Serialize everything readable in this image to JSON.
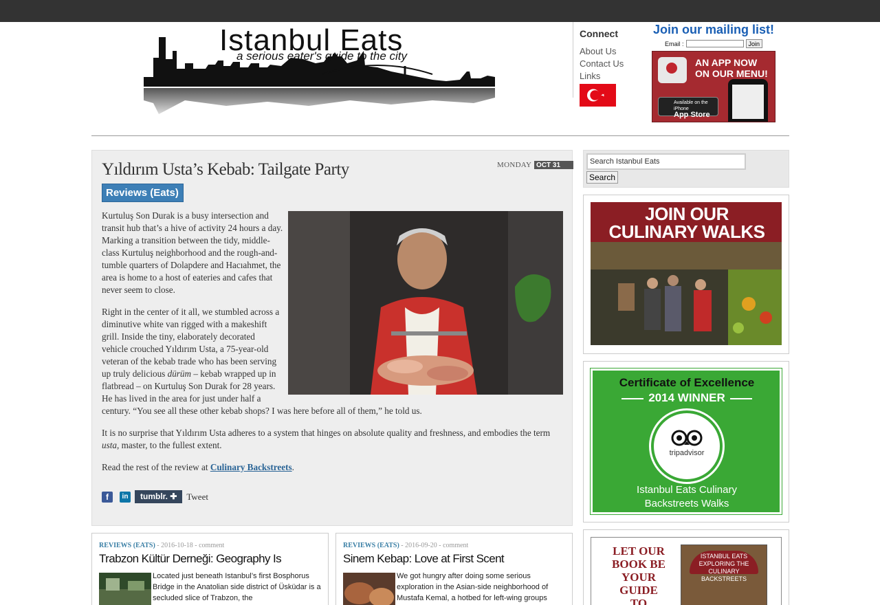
{
  "header": {
    "logo_title": "Istanbul Eats",
    "logo_tagline": "a serious eater's guide to the city",
    "connect": {
      "title": "Connect",
      "links": [
        "About Us",
        "Contact Us",
        "Links"
      ]
    },
    "mailing": {
      "title": "Join our mailing list!",
      "email_label": "Email :",
      "email_value": "",
      "join_label": "Join"
    },
    "app_ad": {
      "line1": "AN APP NOW",
      "line2": "ON OUR MENU!",
      "store_small": "Available on the iPhone",
      "store_big": "App Store"
    }
  },
  "article": {
    "title": "Yıldırım Usta’s Kebab: Tailgate Party",
    "day": "MONDAY",
    "date": "OCT 31",
    "category": "Reviews (Eats)",
    "p1": "Kurtuluş Son Durak is a busy intersection and transit hub that’s a hive of activity 24 hours a day. Marking a transition between the tidy, middle-class Kurtuluş neighborhood and the rough-and-tumble quarters of Dolapdere and Hacıahmet, the area is home to a host of eateries and cafes that never seem to close.",
    "p2a": "Right in the center of it all, we stumbled across a diminutive white van rigged with a makeshift grill. Inside the tiny, elaborately decorated vehicle crouched Yıldırım Usta, a 75-year-old veteran of the kebab trade who has been serving up truly delicious ",
    "p2em": "dürüm",
    "p2b": " – kebab wrapped up in flatbread – on Kurtuluş Son Durak for 28 years. He has lived in the area for just under half a century. “You see all these other kebab shops? I was here before all of them,” he told us.",
    "p3a": "It is no surprise that Yıldırım Usta adheres to a system that hinges on absolute quality and freshness, and embodies the term ",
    "p3em": "usta",
    "p3b": ", master, to the fullest extent.",
    "p4a": "Read the rest of the review at ",
    "p4link": "Culinary Backstreets",
    "p4b": ".",
    "share": {
      "facebook": "f",
      "linkedin": "in",
      "tumblr": "tumblr. ✚",
      "tweet": "Tweet"
    }
  },
  "teasers": [
    {
      "category": "REVIEWS (EATS)",
      "date": " - 2016-10-18 - ",
      "comment": "comment",
      "title": "Trabzon Kültür Derneği: Geography Is",
      "excerpt": "Located just beneath Istanbul’s first Bosphorus Bridge in the Anatolian side district of Üsküdar is a secluded slice of Trabzon, the"
    },
    {
      "category": "REVIEWS (EATS)",
      "date": " - 2016-09-20 - ",
      "comment": "comment",
      "title": "Sinem Kebap: Love at First Scent",
      "excerpt": "We got hungry after doing some serious exploration in the Asian-side neighborhood of Mustafa Kemal, a hotbed for left-wing groups"
    }
  ],
  "sidebar": {
    "search_value": "Search Istanbul Eats",
    "search_button": "Search",
    "walks_line1": "JOIN OUR",
    "walks_line2": "CULINARY WALKS",
    "cert_line1": "Certificate of Excellence",
    "cert_line2": "2014 WINNER",
    "cert_brand": "tripadvisor",
    "cert_bottom1": "Istanbul Eats Culinary",
    "cert_bottom2": "Backstreets Walks",
    "book_text": "LET OUR BOOK BE YOUR GUIDE TO ISTANBUL",
    "book_cover": "ISTANBUL EATS EXPLORING THE CULINARY BACKSTREETS"
  },
  "colors": {
    "topbar": "#333333",
    "accent_blue": "#3d7fb6",
    "mailing_blue": "#1a5fb4",
    "brand_red": "#8b1e24",
    "tripadvisor_green": "#3aa835"
  }
}
